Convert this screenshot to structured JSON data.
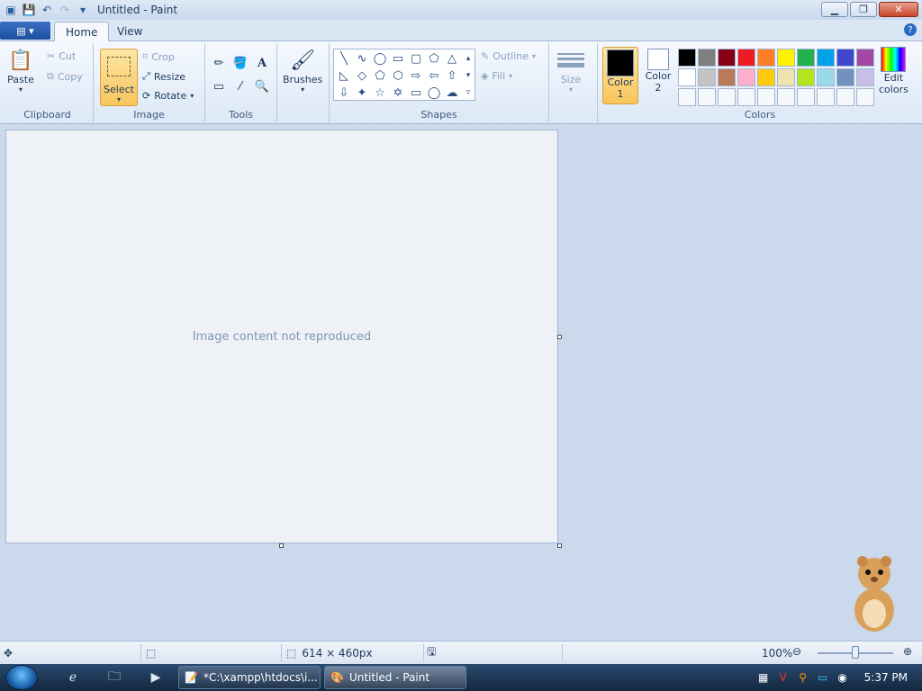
{
  "window": {
    "title": "Untitled - Paint",
    "min_icon": "minimize-icon",
    "max_icon": "restore-icon",
    "close_icon": "close-icon"
  },
  "tabs": {
    "home": "Home",
    "view": "View"
  },
  "ribbon": {
    "clipboard": {
      "label": "Clipboard",
      "paste": "Paste",
      "cut": "Cut",
      "copy": "Copy"
    },
    "image": {
      "label": "Image",
      "select": "Select",
      "crop": "Crop",
      "resize": "Resize",
      "rotate": "Rotate"
    },
    "tools": {
      "label": "Tools"
    },
    "brushes": {
      "label": "Brushes"
    },
    "shapes": {
      "label": "Shapes",
      "outline": "Outline",
      "fill": "Fill"
    },
    "size": {
      "label": "Size"
    },
    "colors": {
      "label": "Colors",
      "color1": "Color",
      "color1_num": "1",
      "color2": "Color",
      "color2_num": "2",
      "edit": "Edit",
      "edit2": "colors",
      "color1_value": "#000000",
      "color2_value": "#ffffff",
      "palette": [
        "#000000",
        "#7f7f7f",
        "#880015",
        "#ed1c24",
        "#ff7f27",
        "#fff200",
        "#22b14c",
        "#00a2e8",
        "#3f48cc",
        "#a349a4",
        "#ffffff",
        "#c3c3c3",
        "#b97a57",
        "#ffaec9",
        "#ffc90e",
        "#efe4b0",
        "#b5e61d",
        "#99d9ea",
        "#7092be",
        "#c8bfe7",
        "",
        "",
        "",
        "",
        "",
        "",
        "",
        "",
        "",
        ""
      ]
    }
  },
  "canvas": {
    "placeholder": "Image content not reproduced"
  },
  "status": {
    "dimensions": "614 × 460px",
    "zoom": "100%"
  },
  "taskbar": {
    "task1": "*C:\\xampp\\htdocs\\i...",
    "task2": "Untitled - Paint",
    "clock": "5:37 PM"
  }
}
